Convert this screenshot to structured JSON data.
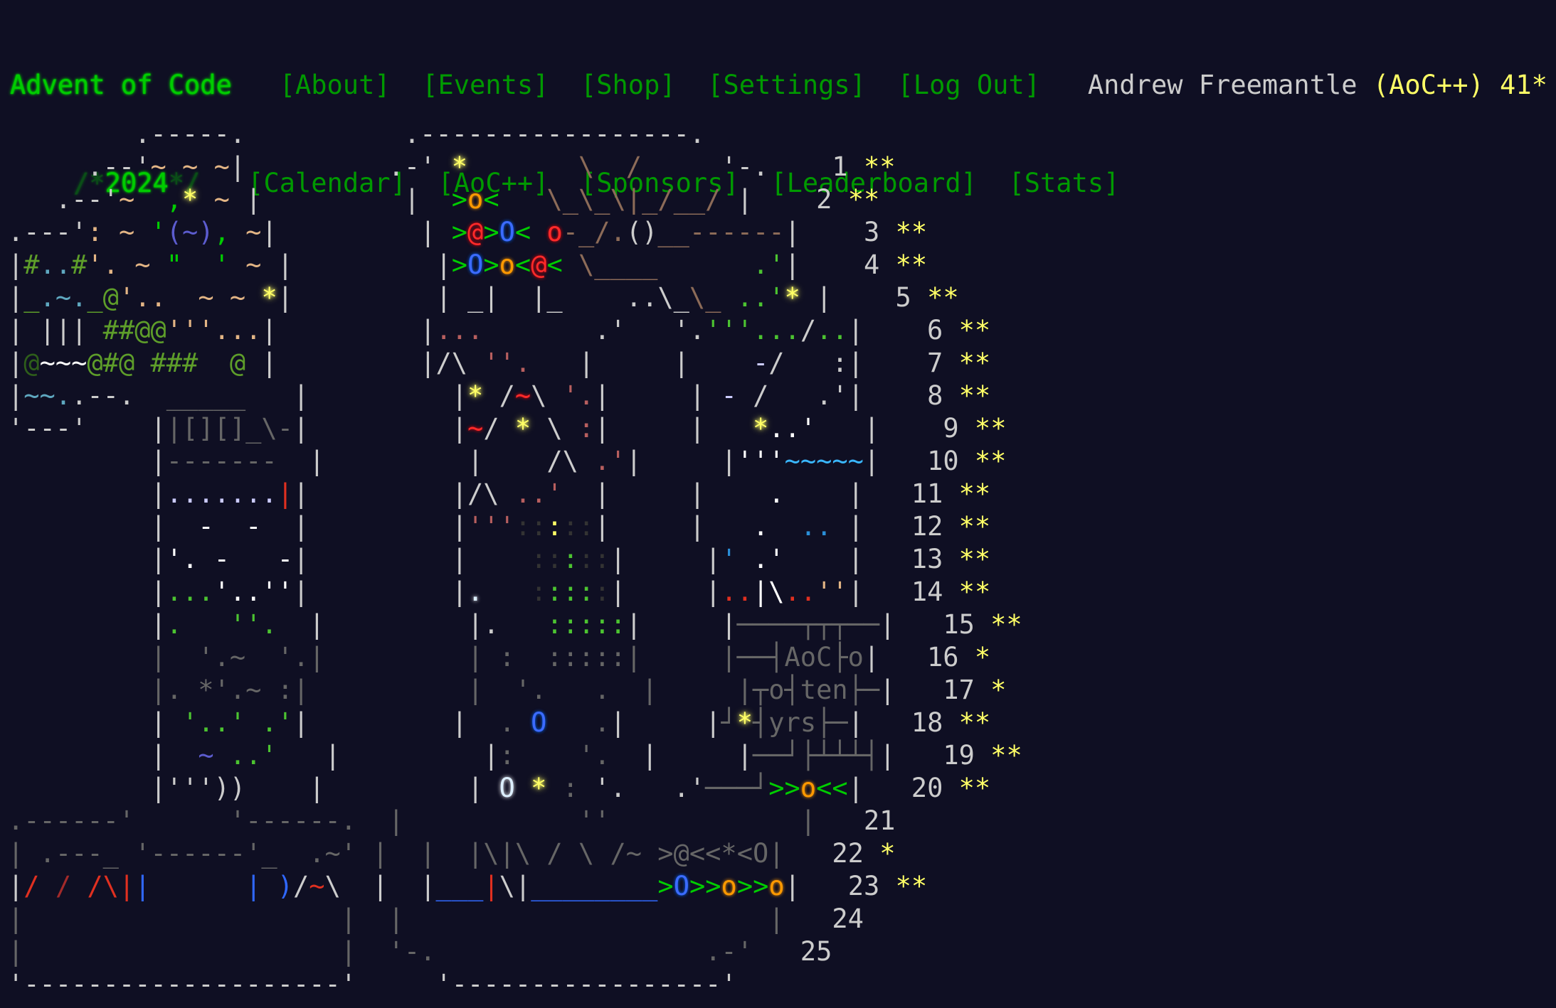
{
  "header": {
    "title": "Advent of Code",
    "year_prefix": "/*",
    "year": "2024",
    "year_suffix": "*/",
    "nav_primary": [
      {
        "label": "[About]"
      },
      {
        "label": "[Events]"
      },
      {
        "label": "[Shop]"
      },
      {
        "label": "[Settings]"
      },
      {
        "label": "[Log Out]"
      }
    ],
    "nav_secondary": [
      {
        "label": "[Calendar]"
      },
      {
        "label": "[AoC++]"
      },
      {
        "label": "[Sponsors]"
      },
      {
        "label": "[Leaderboard]"
      },
      {
        "label": "[Stats]"
      }
    ],
    "user": {
      "name": "Andrew Freemantle",
      "supporter_badge": "(AoC++)",
      "star_count": "41*"
    }
  },
  "colors": {
    "background": "#0f0f23",
    "title_green": "#00cc00",
    "link_green": "#009900",
    "star_gold": "#ffff66",
    "text": "#cccccc"
  },
  "calendar": {
    "days": [
      {
        "day": "1",
        "stars": "**"
      },
      {
        "day": "2",
        "stars": "**"
      },
      {
        "day": "3",
        "stars": "**"
      },
      {
        "day": "4",
        "stars": "**"
      },
      {
        "day": "5",
        "stars": "**"
      },
      {
        "day": "6",
        "stars": "**"
      },
      {
        "day": "7",
        "stars": "**"
      },
      {
        "day": "8",
        "stars": "**"
      },
      {
        "day": "9",
        "stars": "**"
      },
      {
        "day": "10",
        "stars": "**"
      },
      {
        "day": "11",
        "stars": "**"
      },
      {
        "day": "12",
        "stars": "**"
      },
      {
        "day": "13",
        "stars": "**"
      },
      {
        "day": "14",
        "stars": "**"
      },
      {
        "day": "15",
        "stars": "**"
      },
      {
        "day": "16",
        "stars": "*"
      },
      {
        "day": "17",
        "stars": "*"
      },
      {
        "day": "18",
        "stars": "**"
      },
      {
        "day": "19",
        "stars": "**"
      },
      {
        "day": "20",
        "stars": "**"
      },
      {
        "day": "21",
        "stars": ""
      },
      {
        "day": "22",
        "stars": "*"
      },
      {
        "day": "23",
        "stars": "**"
      },
      {
        "day": "24",
        "stars": ""
      },
      {
        "day": "25",
        "stars": ""
      }
    ],
    "art_rows": [
      [
        [
          "g",
          "        .-----.          .-----------------.       "
        ]
      ],
      [
        [
          "g",
          "     .--'"
        ],
        [
          "tan",
          "~ ~ ~"
        ],
        [
          "g",
          "|         .-' "
        ],
        [
          "y",
          "*"
        ],
        [
          "br",
          "       \\  /     "
        ],
        [
          "g",
          "'-.   "
        ]
      ],
      [
        [
          "g",
          "   .--'"
        ],
        [
          "tan",
          "~  "
        ],
        [
          "gr",
          ","
        ],
        [
          "y",
          "*"
        ],
        [
          "tan",
          " ~ "
        ],
        [
          "g",
          "|         |  "
        ],
        [
          "gr",
          ">"
        ],
        [
          "or",
          "o"
        ],
        [
          "gr",
          "<"
        ],
        [
          "br",
          "   \\_\\_\\|_/__/ "
        ],
        [
          "g",
          "|   "
        ]
      ],
      [
        [
          "g",
          ".---'"
        ],
        [
          "tan",
          ": ~ "
        ],
        [
          "gr",
          "'"
        ],
        [
          "ind",
          "(~)"
        ],
        [
          "gr",
          ", "
        ],
        [
          "tan",
          "~"
        ],
        [
          "g",
          "|         | "
        ],
        [
          "gr",
          ">"
        ],
        [
          "rd",
          "@"
        ],
        [
          "gr",
          ">"
        ],
        [
          "bl",
          "O"
        ],
        [
          "gr",
          "<"
        ],
        [
          "g",
          " "
        ],
        [
          "rd",
          "o"
        ],
        [
          "br",
          "-_/."
        ],
        [
          "g",
          "()"
        ],
        [
          "br",
          "__------"
        ],
        [
          "g",
          "|   "
        ]
      ],
      [
        [
          "g",
          "|"
        ],
        [
          "gg",
          "#"
        ],
        [
          "cy",
          ".."
        ],
        [
          "gg",
          "#"
        ],
        [
          "tan",
          "'. ~ "
        ],
        [
          "gr",
          "\"  '"
        ],
        [
          "tan",
          " ~ "
        ],
        [
          "g",
          "|         |"
        ],
        [
          "gr",
          ">"
        ],
        [
          "bl",
          "O"
        ],
        [
          "gr",
          ">"
        ],
        [
          "or",
          "o"
        ],
        [
          "gr",
          "<"
        ],
        [
          "rd",
          "@"
        ],
        [
          "gr",
          "<"
        ],
        [
          "br",
          " \\____"
        ],
        [
          "fgr",
          "      .'"
        ],
        [
          "g",
          "|   "
        ]
      ],
      [
        [
          "g",
          "|"
        ],
        [
          "gg",
          "_"
        ],
        [
          "cy",
          "."
        ],
        [
          "cy",
          "~"
        ],
        [
          "cy",
          "."
        ],
        [
          "gg",
          "_@"
        ],
        [
          "tan",
          "'..  ~ ~ "
        ],
        [
          "y",
          "*"
        ],
        [
          "g",
          "|         | _|  |_    ..\\_"
        ],
        [
          "br",
          "\\_"
        ],
        [
          "fgr",
          " ..'"
        ],
        [
          "y",
          "*"
        ],
        [
          "g",
          " |   "
        ]
      ],
      [
        [
          "g",
          "| ||| "
        ],
        [
          "gg",
          "##@@"
        ],
        [
          "tan",
          "'''..."
        ],
        [
          "g",
          "|         |"
        ],
        [
          "mau",
          "...       "
        ],
        [
          "g",
          ".'   '."
        ],
        [
          "fgr",
          "'''..."
        ],
        [
          "g",
          "/"
        ],
        [
          "fgr",
          ".."
        ],
        [
          "g",
          "|   "
        ]
      ],
      [
        [
          "g",
          "|"
        ],
        [
          "ggd",
          "@"
        ],
        [
          "w",
          "~~~"
        ],
        [
          "gg",
          "@#@ ###  @ "
        ],
        [
          "g",
          "|         |/\\ "
        ],
        [
          "mau",
          "''.   "
        ],
        [
          "g",
          "|     |    "
        ],
        [
          "lav",
          "-"
        ],
        [
          "g",
          "/   :|   "
        ]
      ],
      [
        [
          "g",
          "|"
        ],
        [
          "cy",
          "~~"
        ],
        [
          "cy",
          "."
        ],
        [
          "g",
          ".--.  "
        ],
        [
          "dg",
          "_____"
        ],
        [
          "g",
          "   |         |"
        ],
        [
          "y",
          "*"
        ],
        [
          "g",
          " /"
        ],
        [
          "rd",
          "~"
        ],
        [
          "g",
          "\\ "
        ],
        [
          "mau",
          "'."
        ],
        [
          "g",
          "|     | "
        ],
        [
          "lav",
          "-"
        ],
        [
          "g",
          " /   .'|   "
        ]
      ],
      [
        [
          "g",
          "'---'    |"
        ],
        [
          "dg",
          "|[][]_\\-"
        ],
        [
          "g",
          "|         |"
        ],
        [
          "rd",
          "~"
        ],
        [
          "g",
          "/ "
        ],
        [
          "y",
          "*"
        ],
        [
          "g",
          " \\ "
        ],
        [
          "mau",
          ":"
        ],
        [
          "g",
          "|     |   "
        ],
        [
          "y",
          "*"
        ],
        [
          "w",
          "..'"
        ],
        [
          "g",
          "   |   "
        ]
      ],
      [
        [
          "g",
          "         |"
        ],
        [
          "dg",
          "-------"
        ],
        [
          "g",
          "  |         |    /\\ "
        ],
        [
          "mau",
          ".'"
        ],
        [
          "g",
          "|     |"
        ],
        [
          "w",
          "'''"
        ],
        [
          "sky",
          "~~~~~"
        ],
        [
          "g",
          "|   "
        ]
      ],
      [
        [
          "g",
          "         |"
        ],
        [
          "lav",
          "......."
        ],
        [
          "rdf",
          "|"
        ],
        [
          "g",
          "|         |/\\ "
        ],
        [
          "mau",
          "..'"
        ],
        [
          "g",
          "  |     |    "
        ],
        [
          "w",
          "."
        ],
        [
          "g",
          "    |   "
        ]
      ],
      [
        [
          "g",
          "         |"
        ],
        [
          "w",
          "  -  -  "
        ],
        [
          "g",
          "|         |"
        ],
        [
          "mau",
          "'''"
        ],
        [
          "dk",
          "::"
        ],
        [
          "ys",
          ":"
        ],
        [
          "dk",
          "::"
        ],
        [
          "g",
          "|     |   "
        ],
        [
          "w",
          "."
        ],
        [
          "sk2",
          "  .. "
        ],
        [
          "g",
          "|   "
        ]
      ],
      [
        [
          "g",
          "         |"
        ],
        [
          "w",
          "'. -   -"
        ],
        [
          "g",
          "|         |    "
        ],
        [
          "dk",
          "::"
        ],
        [
          "fgr",
          ":"
        ],
        [
          "dk",
          "::"
        ],
        [
          "g",
          "|     |"
        ],
        [
          "sk2",
          "'"
        ],
        [
          "w",
          " .'"
        ],
        [
          "g",
          "    |   "
        ]
      ],
      [
        [
          "g",
          "         |"
        ],
        [
          "fgr",
          "..."
        ],
        [
          "w",
          "'..''"
        ],
        [
          "g",
          "|         |"
        ],
        [
          "lw",
          "."
        ],
        [
          "g",
          "   "
        ],
        [
          "dk",
          ":"
        ],
        [
          "fgr",
          ":::"
        ],
        [
          "dk",
          ":"
        ],
        [
          "g",
          "|     |"
        ],
        [
          "rdf",
          ".."
        ],
        [
          "w",
          "|\\"
        ],
        [
          "rdf",
          ".."
        ],
        [
          "tan",
          "''"
        ],
        [
          "g",
          "|   "
        ]
      ],
      [
        [
          "g",
          "         |"
        ],
        [
          "fgr",
          ".   ''.  "
        ],
        [
          "g",
          "|         |.   "
        ],
        [
          "fgr",
          ":::::"
        ],
        [
          "g",
          "|     |"
        ],
        [
          "dg",
          "────┬┬┬──"
        ],
        [
          "g",
          "|   "
        ]
      ],
      [
        [
          "dg",
          "         |  '.~  '.|         | :  :::::|     |──┤AoC├o"
        ],
        [
          "g",
          "|   "
        ]
      ],
      [
        [
          "dg",
          "         |. *'.~ :|          |  '.   .  |     |┬o┤ten├─"
        ],
        [
          "g",
          "|   "
        ]
      ],
      [
        [
          "g",
          "         |"
        ],
        [
          "fgr",
          " '..' .'"
        ],
        [
          "g",
          "|         |  "
        ],
        [
          "dg",
          ". "
        ],
        [
          "bl",
          "O"
        ],
        [
          "dg",
          "   ."
        ],
        [
          "g",
          "|     |"
        ],
        [
          "dg",
          "┘"
        ],
        [
          "y",
          "*"
        ],
        [
          "dg",
          "┤yrs├─"
        ],
        [
          "g",
          "|   "
        ]
      ],
      [
        [
          "g",
          "         |"
        ],
        [
          "ind",
          "  ~"
        ],
        [
          "fgr",
          " ..'"
        ],
        [
          "g",
          "   |         |"
        ],
        [
          "dg",
          ":    '.  "
        ],
        [
          "g",
          "|     |"
        ],
        [
          "dg",
          "──┘├┴┴┴┤"
        ],
        [
          "g",
          "|   "
        ]
      ],
      [
        [
          "g",
          "         |'''))    |         |"
        ],
        [
          "lw",
          " O "
        ],
        [
          "y",
          "*"
        ],
        [
          "dg",
          " :"
        ],
        [
          "g",
          " '.   .'"
        ],
        [
          "dg",
          "───┘"
        ],
        [
          "gr",
          ">>"
        ],
        [
          "or",
          "o"
        ],
        [
          "gr",
          "<<"
        ],
        [
          "g",
          "|   "
        ]
      ],
      [
        [
          "dg",
          ".------'      '------.  |           ''            |   "
        ]
      ],
      [
        [
          "dg",
          "| .---_ '------'_  .~' |  |  |\\|\\ / \\ /~ >@<<*<O|   "
        ]
      ],
      [
        [
          "g",
          "|"
        ],
        [
          "rdf",
          "/"
        ],
        [
          "rdd",
          " /"
        ],
        [
          "rdf",
          " /\\|"
        ],
        [
          "blf",
          "|"
        ],
        [
          "g",
          "      "
        ],
        [
          "blf",
          "|"
        ],
        [
          "g",
          " "
        ],
        [
          "blf",
          ")"
        ],
        [
          "g",
          "/"
        ],
        [
          "rdf",
          "~"
        ],
        [
          "g",
          "\\  |  |"
        ],
        [
          "blf",
          "___"
        ],
        [
          "rdf",
          "|"
        ],
        [
          "g",
          "\\|"
        ],
        [
          "blf",
          "________"
        ],
        [
          "gr",
          ">"
        ],
        [
          "bl",
          "O"
        ],
        [
          "gr",
          ">>"
        ],
        [
          "or",
          "o"
        ],
        [
          "gr",
          ">>"
        ],
        [
          "or",
          "o"
        ],
        [
          "g",
          "|   "
        ]
      ],
      [
        [
          "dg",
          "|                    |  |                       |   "
        ]
      ],
      [
        [
          "dg",
          "|                    |  '-.                 .-'   "
        ]
      ],
      [
        [
          "g",
          "'--------------------'     '-----------------'     "
        ]
      ]
    ]
  }
}
